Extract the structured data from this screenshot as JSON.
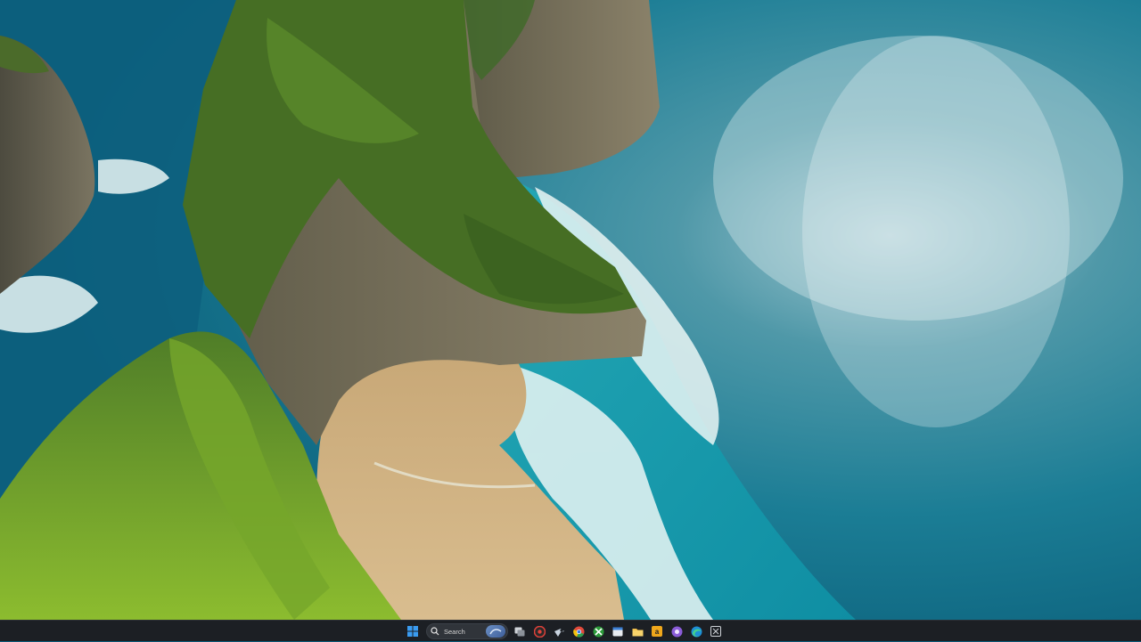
{
  "desktop": {
    "wallpaper": "coastal-cliff-beach-wallpaper"
  },
  "taskbar": {
    "search": {
      "placeholder": "Search"
    },
    "pinned": [
      {
        "name": "task-view",
        "icon": "task-view-icon"
      },
      {
        "name": "app-red-circle",
        "icon": "red-app-icon"
      },
      {
        "name": "steam",
        "icon": "steam-icon"
      },
      {
        "name": "chrome",
        "icon": "chrome-icon"
      },
      {
        "name": "xbox",
        "icon": "xbox-icon"
      },
      {
        "name": "calendar-app",
        "icon": "calendar-app-icon"
      },
      {
        "name": "file-explorer",
        "icon": "folder-icon"
      },
      {
        "name": "amazon-app",
        "icon": "amazon-app-icon"
      },
      {
        "name": "discord-like",
        "icon": "purple-app-icon"
      },
      {
        "name": "edge",
        "icon": "edge-icon"
      },
      {
        "name": "snipping-tool",
        "icon": "snip-icon"
      }
    ],
    "colors": {
      "bar": "#1c1f24",
      "accent": "#3a9bf0"
    }
  }
}
